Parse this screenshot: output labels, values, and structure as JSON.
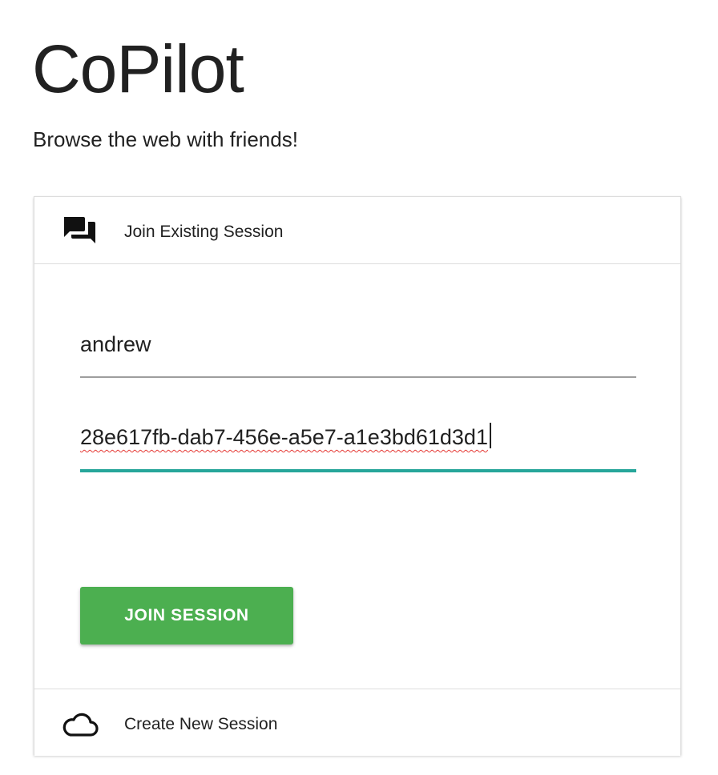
{
  "app": {
    "title": "CoPilot",
    "subtitle": "Browse the web with friends!"
  },
  "join_section": {
    "header_label": "Join Existing Session",
    "header_icon": "forum-icon",
    "name_value": "andrew",
    "session_id_value": "28e617fb-dab7-456e-a5e7-a1e3bd61d3d1",
    "submit_label": "JOIN SESSION"
  },
  "create_section": {
    "header_label": "Create New Session",
    "header_icon": "cloud-icon"
  },
  "colors": {
    "accent_teal": "#26a69a",
    "button_green": "#4caf50",
    "text": "#212121"
  }
}
